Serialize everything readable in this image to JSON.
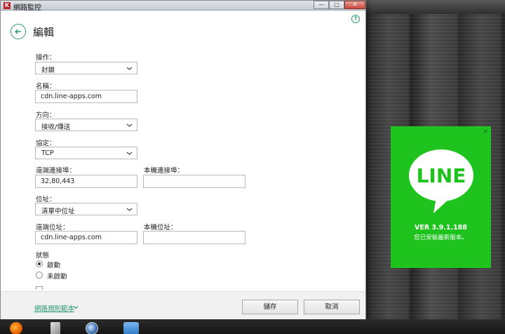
{
  "window": {
    "title": "網路監控",
    "min_glyph": "—",
    "max_glyph": "□",
    "close_glyph": "✕"
  },
  "header": {
    "title": "編輯",
    "help_glyph": "?"
  },
  "form": {
    "action": {
      "label": "操作：",
      "value": "封鎖"
    },
    "name": {
      "label": "名稱：",
      "value": "cdn.line-apps.com"
    },
    "direction": {
      "label": "方向：",
      "value": "接收/傳送"
    },
    "protocol": {
      "label": "協定：",
      "value": "TCP"
    },
    "remote_port": {
      "label": "遠端連接埠：",
      "value": "32,80,443"
    },
    "local_port": {
      "label": "本機連接埠：",
      "value": ""
    },
    "address": {
      "label": "位址：",
      "value": "清單中位址"
    },
    "remote_address": {
      "label": "遠端位址：",
      "value": "cdn.line-apps.com"
    },
    "local_address": {
      "label": "本機位址：",
      "value": ""
    },
    "status": {
      "label": "狀態",
      "options": [
        {
          "label": "啟動",
          "selected": true
        },
        {
          "label": "未啟動",
          "selected": false
        }
      ]
    }
  },
  "footer": {
    "link": "網路規則範本",
    "save_label": "儲存",
    "cancel_label": "取消"
  },
  "line_popup": {
    "logo_text": "LINE",
    "version": "VER 3.9.1.188",
    "message": "您已安裝最新版本。",
    "close_glyph": "×",
    "brand_color": "#1fc31e"
  },
  "taskbar": {
    "icons": [
      "firefox-icon",
      "tool-icon",
      "globe-icon",
      "app-icon"
    ]
  },
  "colors": {
    "accent": "#2a9b72"
  }
}
